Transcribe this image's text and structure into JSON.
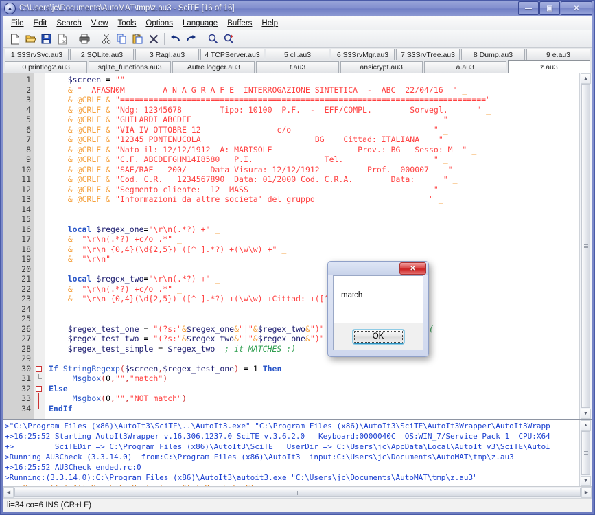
{
  "window": {
    "title": "C:\\Users\\jc\\Documents\\AutoMAT\\tmp\\z.au3 - SciTE [16 of 16]",
    "app_icon": "autoit-scite-icon",
    "minimize_label": "—",
    "maximize_label": "▣",
    "close_label": "✕"
  },
  "menu": [
    {
      "label": "File"
    },
    {
      "label": "Edit"
    },
    {
      "label": "Search"
    },
    {
      "label": "View"
    },
    {
      "label": "Tools"
    },
    {
      "label": "Options"
    },
    {
      "label": "Language"
    },
    {
      "label": "Buffers"
    },
    {
      "label": "Help"
    }
  ],
  "toolbar": [
    {
      "name": "new-file-icon",
      "title": "New"
    },
    {
      "name": "open-file-icon",
      "title": "Open"
    },
    {
      "name": "save-file-icon",
      "title": "Save"
    },
    {
      "name": "close-file-icon",
      "title": "Close"
    },
    {
      "name": "print-icon",
      "title": "Print"
    },
    {
      "name": "cut-icon",
      "title": "Cut"
    },
    {
      "name": "copy-icon",
      "title": "Copy"
    },
    {
      "name": "paste-icon",
      "title": "Paste"
    },
    {
      "name": "delete-icon",
      "title": "Delete"
    },
    {
      "name": "undo-icon",
      "title": "Undo"
    },
    {
      "name": "redo-icon",
      "title": "Redo"
    },
    {
      "name": "find-icon",
      "title": "Find"
    },
    {
      "name": "replace-icon",
      "title": "Replace"
    }
  ],
  "tabs_row1": [
    {
      "label": "1 S3SrvSvc.au3",
      "active": false
    },
    {
      "label": "2 SQLite.au3",
      "active": false
    },
    {
      "label": "3 RagI.au3",
      "active": false
    },
    {
      "label": "4 TCPServer.au3",
      "active": false
    },
    {
      "label": "5 cli.au3",
      "active": false
    },
    {
      "label": "6 S3SrvMgr.au3",
      "active": false
    },
    {
      "label": "7 S3SrvTree.au3",
      "active": false
    },
    {
      "label": "8 Dump.au3",
      "active": false
    },
    {
      "label": "9 e.au3",
      "active": false
    }
  ],
  "tabs_row2": [
    {
      "label": "0 printlog2.au3",
      "active": false
    },
    {
      "label": "sqlite_functions.au3",
      "active": false
    },
    {
      "label": "Autre logger.au3",
      "active": false
    },
    {
      "label": "t.au3",
      "active": false
    },
    {
      "label": "ansicrypt.au3",
      "active": false
    },
    {
      "label": "a.au3",
      "active": false
    },
    {
      "label": "z.au3",
      "active": true
    }
  ],
  "editor": {
    "first_line": 1,
    "last_line": 34,
    "lines": [
      {
        "n": 1,
        "html": "    <span class='var'>$screen</span> = <span class='str'>\"\"</span> <span class='amp'>_</span>"
      },
      {
        "n": 2,
        "html": "    <span class='amp'>&amp;</span> <span class='str'>\"  AFASN0M        A N A G R A F E  INTERROGAZIONE SINTETICA  -  ABC  22/04/16  \"</span> <span class='amp'>_</span>"
      },
      {
        "n": 3,
        "html": "    <span class='amp'>&amp;</span> <span class='amp'>@CRLF</span> <span class='amp'>&amp;</span> <span class='str'>\"=============================================================================\"</span> <span class='amp'>_</span>"
      },
      {
        "n": 4,
        "html": "    <span class='amp'>&amp;</span> <span class='amp'>@CRLF</span> <span class='amp'>&amp;</span> <span class='str'>\"Ndg: 12345678        Tipo: 10100  P.F.  -  EFF/COMPL.        Sorvegl.      \"</span> <span class='amp'>_</span>"
      },
      {
        "n": 5,
        "html": "    <span class='amp'>&amp;</span> <span class='amp'>@CRLF</span> <span class='amp'>&amp;</span> <span class='str'>\"GHILARDI ABCDEF                                                     \"</span> <span class='amp'>_</span>"
      },
      {
        "n": 6,
        "html": "    <span class='amp'>&amp;</span> <span class='amp'>@CRLF</span> <span class='amp'>&amp;</span> <span class='str'>\"VIA IV OTTOBRE 12                c/o                              \"</span> <span class='amp'>_</span>"
      },
      {
        "n": 7,
        "html": "    <span class='amp'>&amp;</span> <span class='amp'>@CRLF</span> <span class='amp'>&amp;</span> <span class='str'>\"12345 PONTENUCOLA                        BG    Cittad: ITALIANA    \"</span> <span class='amp'>_</span>"
      },
      {
        "n": 8,
        "html": "    <span class='amp'>&amp;</span> <span class='amp'>@CRLF</span> <span class='amp'>&amp;</span> <span class='str'>\"Nato il: 12/12/1912  A: MARISOLE                  Prov.: BG   Sesso: M  \"</span> <span class='amp'>_</span>"
      },
      {
        "n": 9,
        "html": "    <span class='amp'>&amp;</span> <span class='amp'>@CRLF</span> <span class='amp'>&amp;</span> <span class='str'>\"C.F. ABCDEFGHM14I8580   P.I.               Tel.                   \"</span> <span class='amp'>_</span>"
      },
      {
        "n": 10,
        "html": "    <span class='amp'>&amp;</span> <span class='amp'>@CRLF</span> <span class='amp'>&amp;</span> <span class='str'>\"SAE/RAE   200/     Data Visura: 12/12/1912          Prof.  000007    \"</span> <span class='amp'>_</span>"
      },
      {
        "n": 11,
        "html": "    <span class='amp'>&amp;</span> <span class='amp'>@CRLF</span> <span class='amp'>&amp;</span> <span class='str'>\"Cod. C.R.   1234567890  Data: 01/2000 Cod. C.R.A.        Data:      \"</span> <span class='amp'>_</span>"
      },
      {
        "n": 12,
        "html": "    <span class='amp'>&amp;</span> <span class='amp'>@CRLF</span> <span class='amp'>&amp;</span> <span class='str'>\"Segmento cliente:  12  MASS                                       \"</span> <span class='amp'>_</span>"
      },
      {
        "n": 13,
        "html": "    <span class='amp'>&amp;</span> <span class='amp'>@CRLF</span> <span class='amp'>&amp;</span> <span class='str'>\"Informazioni da altre societa' del gruppo                        \"</span> <span class='amp'>_</span>"
      },
      {
        "n": 14,
        "html": ""
      },
      {
        "n": 15,
        "html": ""
      },
      {
        "n": 16,
        "html": "    <span class='kw'>local</span> <span class='var'>$regex_one</span>=<span class='str'>\"\\r\\n(.*?) +\"</span> <span class='amp'>_</span>"
      },
      {
        "n": 17,
        "html": "    <span class='amp'>&amp;</span>  <span class='str'>\"\\r\\n(.*?) +c/o .*\"</span> <span class='amp'>_</span>"
      },
      {
        "n": 18,
        "html": "    <span class='amp'>&amp;</span>  <span class='str'>\"\\r\\n {0,4}(\\d{2,5}) ([^ ].*?) +(\\w\\w) +\"</span> <span class='amp'>_</span>"
      },
      {
        "n": 19,
        "html": "    <span class='amp'>&amp;</span>  <span class='str'>\"\\r\\n\"</span>"
      },
      {
        "n": 20,
        "html": ""
      },
      {
        "n": 21,
        "html": "    <span class='kw'>local</span> <span class='var'>$regex_two</span>=<span class='str'>\"\\r\\n(.*?) +\"</span> <span class='amp'>_</span>"
      },
      {
        "n": 22,
        "html": "    <span class='amp'>&amp;</span>  <span class='str'>\"\\r\\n(.*?) +c/o .*\"</span> <span class='amp'>_</span>"
      },
      {
        "n": 23,
        "html": "    <span class='amp'>&amp;</span>  <span class='str'>\"\\r\\n {0,4}(\\d{2,5}) ([^ ].*?) +(\\w\\w) +Cittad: +([^ ].*?) +\"</span>"
      },
      {
        "n": 24,
        "html": ""
      },
      {
        "n": 25,
        "html": ""
      },
      {
        "n": 26,
        "html": "    <span class='var'>$regex_test_one</span> = <span class='str'>\"(?s:\"</span><span class='amp'>&amp;</span><span class='var'>$regex_one</span><span class='amp'>&amp;</span><span class='str'>\"|\"</span><span class='amp'>&amp;</span><span class='var'>$regex_two</span><span class='amp'>&amp;</span><span class='str'>\")\"</span>  <span class='com'>; it DOESN'T MATCH :(</span>"
      },
      {
        "n": 27,
        "html": "    <span class='var'>$regex_test_two</span> = <span class='str'>\"(?s:\"</span><span class='amp'>&amp;</span><span class='var'>$regex_two</span><span class='amp'>&amp;</span><span class='str'>\"|\"</span><span class='amp'>&amp;</span><span class='var'>$regex_one</span><span class='amp'>&amp;</span><span class='str'>\")\"</span> <span class='com'>; it MATCHES :)</span>"
      },
      {
        "n": 28,
        "html": "    <span class='var'>$regex_test_simple</span> = <span class='var'>$regex_two</span>  <span class='com'>; it MATCHES :)</span>"
      },
      {
        "n": 29,
        "html": ""
      },
      {
        "n": 30,
        "html": "<span class='kw'>If</span> <span class='fn'>StringRegexp</span><span class='paren'>(</span><span class='var'>$screen</span><span class='paren'>,</span><span class='var'>$regex_test_one</span><span class='paren'>)</span> = <span class='num'>1</span> <span class='kw'>Then</span>"
      },
      {
        "n": 31,
        "html": "     <span class='fn'>Msgbox</span><span class='paren'>(</span><span class='num'>0</span><span class='paren'>,</span><span class='str'>\"\"</span><span class='paren'>,</span><span class='str'>\"match\"</span><span class='paren'>)</span>"
      },
      {
        "n": 32,
        "html": "<span class='kw'>Else</span>"
      },
      {
        "n": 33,
        "html": "     <span class='fn'>Msgbox</span><span class='paren'>(</span><span class='num'>0</span><span class='paren'>,</span><span class='str'>\"\"</span><span class='paren'>,</span><span class='str'>\"NOT match\"</span><span class='paren'>)</span>"
      },
      {
        "n": 34,
        "html": "<span class='kw'>EndIf</span>"
      }
    ]
  },
  "msgbox": {
    "message": "match",
    "ok_label": "OK",
    "close_label": "✕"
  },
  "output": {
    "lines": [
      {
        "text": ">\"C:\\Program Files (x86)\\AutoIt3\\SciTE\\..\\AutoIt3.exe\" \"C:\\Program Files (x86)\\AutoIt3\\SciTE\\AutoIt3Wrapper\\AutoIt3Wrapp",
        "color": "blue"
      },
      {
        "text": "+>16:25:52 Starting AutoIt3Wrapper v.16.306.1237.0 SciTE v.3.6.2.0   Keyboard:0000040C  OS:WIN_7/Service Pack 1  CPU:X64",
        "color": "blue"
      },
      {
        "text": "+>         SciTEDir => C:\\Program Files (x86)\\AutoIt3\\SciTE   UserDir => C:\\Users\\jc\\AppData\\Local\\AutoIt v3\\SciTE\\AutoI",
        "color": "blue"
      },
      {
        "text": ">Running AU3Check (3.3.14.0)  from:C:\\Program Files (x86)\\AutoIt3  input:C:\\Users\\jc\\Documents\\AutoMAT\\tmp\\z.au3",
        "color": "blue"
      },
      {
        "text": "+>16:25:52 AU3Check ended.rc:0",
        "color": "blue"
      },
      {
        "text": ">Running:(3.3.14.0):C:\\Program Files (x86)\\AutoIt3\\autoit3.exe \"C:\\Users\\jc\\Documents\\AutoMAT\\tmp\\z.au3\"",
        "color": "blue"
      },
      {
        "text": "--> Press Ctrl+Alt+Break to Restart or Ctrl+Break to Stop",
        "color": "orange"
      }
    ]
  },
  "statusbar": {
    "text": "li=34 co=6 INS (CR+LF)"
  },
  "colors": {
    "string": "#ff4040",
    "macro": "#f5a03c",
    "keyword": "#2b57c8",
    "comment": "#2e9e4f",
    "variable": "#1a1a6e",
    "console_blue": "#1a3fd0",
    "console_orange": "#e07b18",
    "window_chrome": "#7e8cca"
  }
}
